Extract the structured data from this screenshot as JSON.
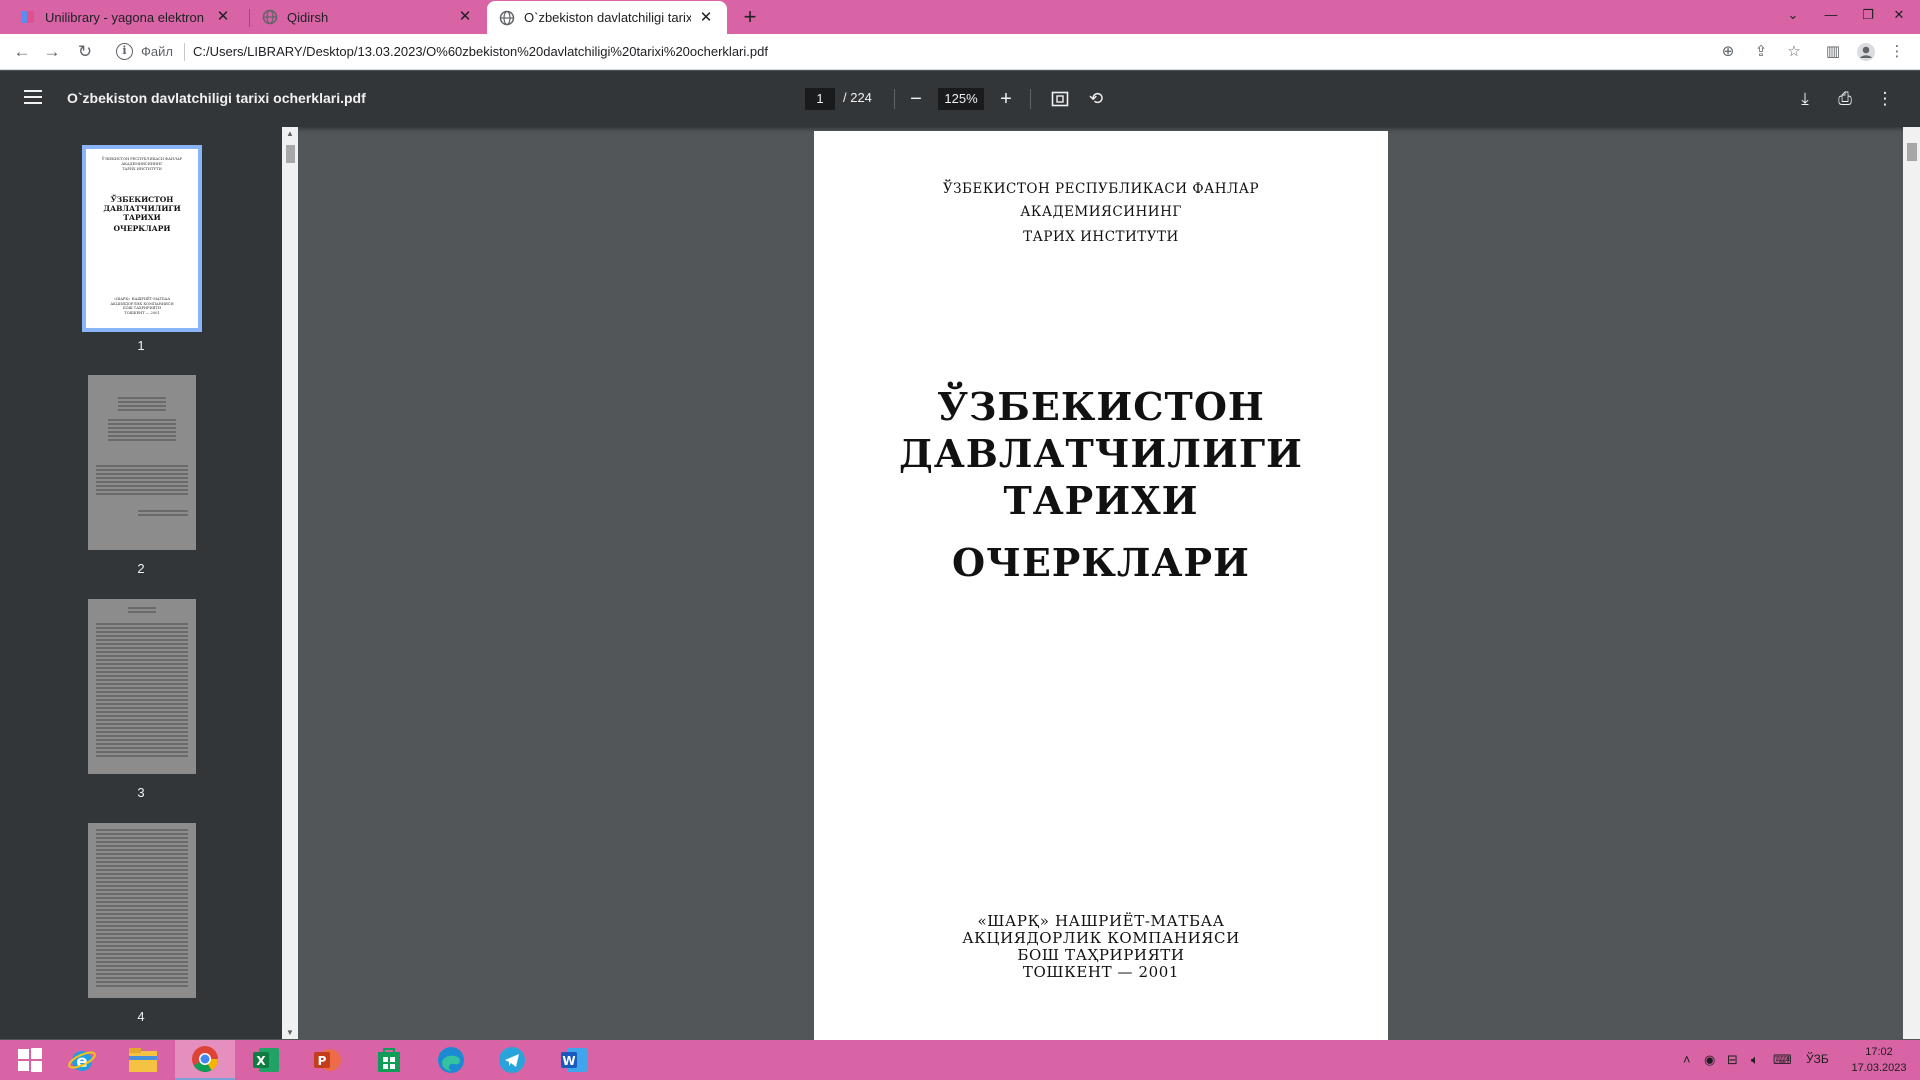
{
  "browser": {
    "tabs": [
      {
        "title": "Unilibrary - yagona elektron kutu",
        "active": false
      },
      {
        "title": "Qidirsh",
        "active": false
      },
      {
        "title": "O`zbekiston davlatchiligi tarixi oc",
        "active": true
      }
    ],
    "scheme_label": "Файл",
    "url": "C:/Users/LIBRARY/Desktop/13.03.2023/O%60zbekiston%20davlatchiligi%20tarixi%20ocherklari.pdf"
  },
  "pdf_viewer": {
    "file_name": "O`zbekiston davlatchiligi tarixi ocherklari.pdf",
    "current_page": "1",
    "total_pages": "/ 224",
    "zoom": "125%",
    "thumbnails": [
      {
        "label": "1",
        "selected": true
      },
      {
        "label": "2",
        "selected": false
      },
      {
        "label": "3",
        "selected": false
      },
      {
        "label": "4",
        "selected": false
      }
    ]
  },
  "document_page": {
    "header_lines": [
      "ЎЗБЕКИСТОН РЕСПУБЛИКАСИ ФАНЛАР",
      "АКАДЕМИЯСИНИНГ",
      "ТАРИХ ИНСТИТУТИ"
    ],
    "title_lines": [
      "ЎЗБЕКИСТОН",
      "ДАВЛАТЧИЛИГИ",
      "ТАРИХИ"
    ],
    "subtitle": "ОЧЕРКЛАРИ",
    "publisher_lines": [
      "«ШАРҚ» НАШРИЁТ-МАТБАА",
      "АКЦИЯДОРЛИК КОМПАНИЯСИ",
      "БОШ ТАҲРИРИЯТИ",
      "ТОШКЕНТ — 2001"
    ]
  },
  "thumbnail_page1": {
    "top_lines": [
      "ЎЗБЕКИСТОН РЕСПУБЛИКАСИ ФАНЛАР",
      "АКАДЕМИЯСИНИНГ",
      "ТАРИХ ИНСТИТУТИ"
    ],
    "title_lines": [
      "ЎЗБЕКИСТОН",
      "ДАВЛАТЧИЛИГИ",
      "ТАРИХИ",
      "ОЧЕРКЛАРИ"
    ],
    "bottom_lines": [
      "«ШАРҚ» НАШРИЁТ-МАТБАА",
      "АКЦИЯДОРЛИК КОМПАНИЯСИ",
      "БОШ ТАҲРИРИЯТИ",
      "ТОШКЕНТ — 2001"
    ]
  },
  "taskbar": {
    "apps": [
      "windows-start",
      "internet-explorer",
      "file-explorer",
      "chrome",
      "excel",
      "powerpoint",
      "microsoft-store",
      "edge",
      "telegram",
      "word"
    ],
    "language": "ЎЗБ",
    "time": "17:02",
    "date": "17.03.2023"
  },
  "colors": {
    "accent": "#d864a6",
    "viewer_bg": "#525659",
    "viewer_bar": "#323639",
    "selection": "#8ab4f8"
  }
}
